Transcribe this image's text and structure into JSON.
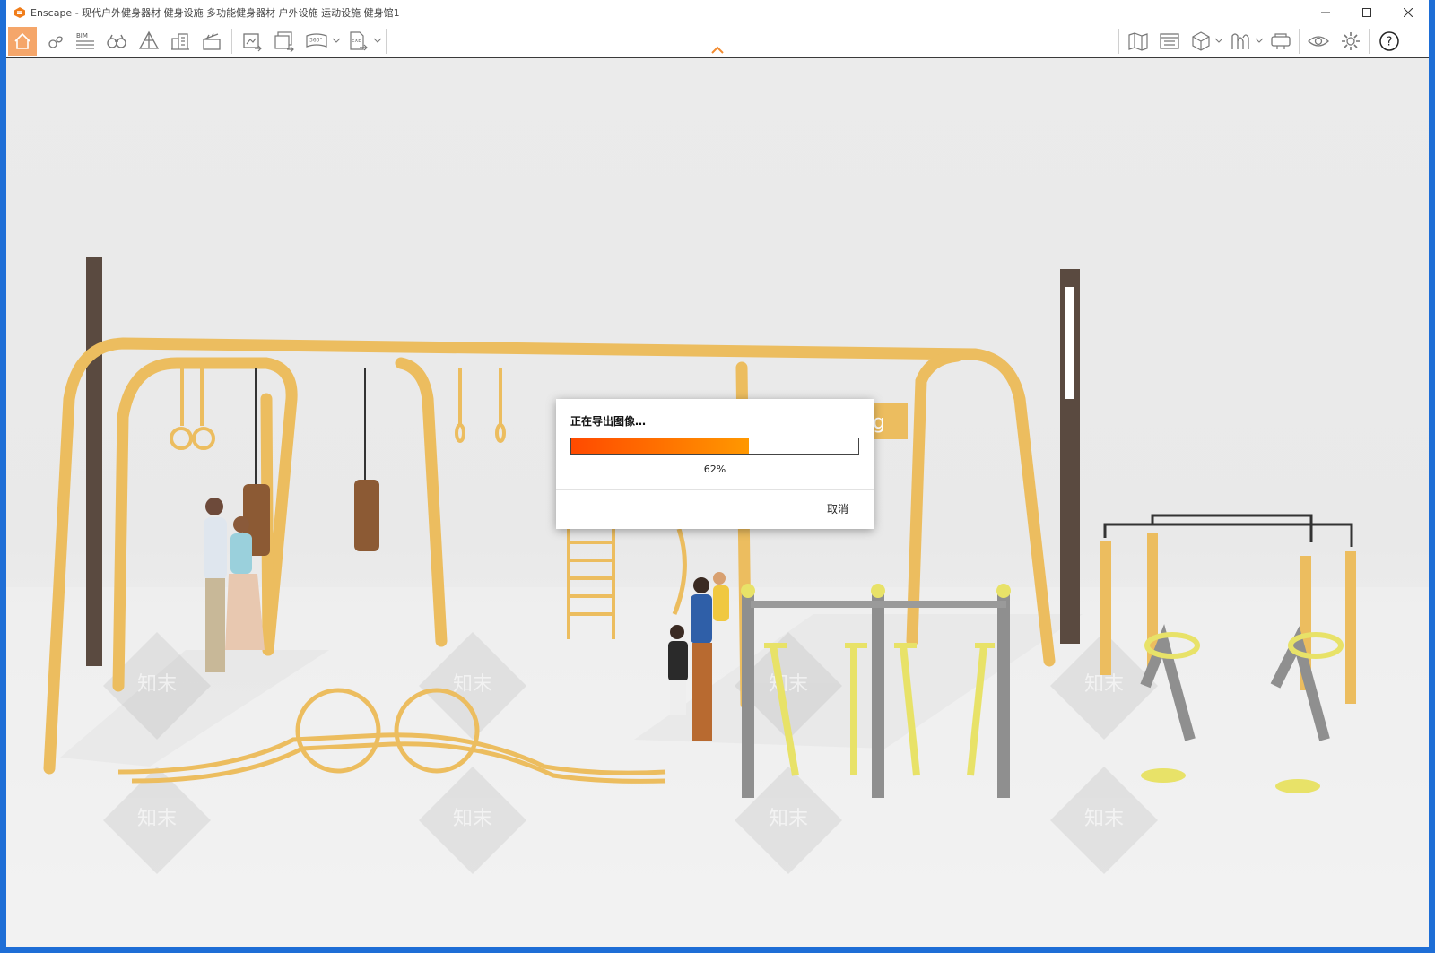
{
  "window": {
    "title": "Enscape - 现代户外健身器材 健身设施 多功能健身器材 户外设施 运动设施 健身馆1",
    "controls": [
      "minimize-icon",
      "maximize-icon",
      "close-icon"
    ]
  },
  "toolbar": {
    "left_tools": [
      {
        "name": "home-icon",
        "active": true
      },
      {
        "name": "location-pin-icon"
      },
      {
        "name": "bim-icon",
        "text": "BIM"
      },
      {
        "name": "binoculars-icon"
      },
      {
        "name": "perspective-icon"
      },
      {
        "name": "buildings-icon"
      },
      {
        "name": "clapperboard-icon"
      },
      {
        "name": "screenshot-export-icon"
      },
      {
        "name": "batch-export-icon"
      },
      {
        "name": "panorama-360-icon",
        "text": "360°"
      },
      {
        "name": "exe-export-icon",
        "text": "EXE"
      }
    ],
    "right_tools": [
      {
        "name": "map-icon"
      },
      {
        "name": "asset-library-icon"
      },
      {
        "name": "cube-icon"
      },
      {
        "name": "material-editor-icon"
      },
      {
        "name": "vr-headset-icon"
      },
      {
        "name": "visual-settings-eye-icon"
      },
      {
        "name": "settings-gear-icon"
      },
      {
        "name": "help-icon",
        "text": "?"
      }
    ]
  },
  "scene": {
    "sign_text": "ng",
    "watermark": "知末"
  },
  "colors": {
    "accent": "#f28b30",
    "frame_yellow": "#ecbd5f",
    "progress_start": "#ff4a00",
    "progress_end": "#ff9800",
    "desktop_blue": "#1e6ed6"
  },
  "dialog": {
    "title": "正在导出图像…",
    "progress": 0.62,
    "progress_label": "62%",
    "cancel_label": "取消"
  }
}
